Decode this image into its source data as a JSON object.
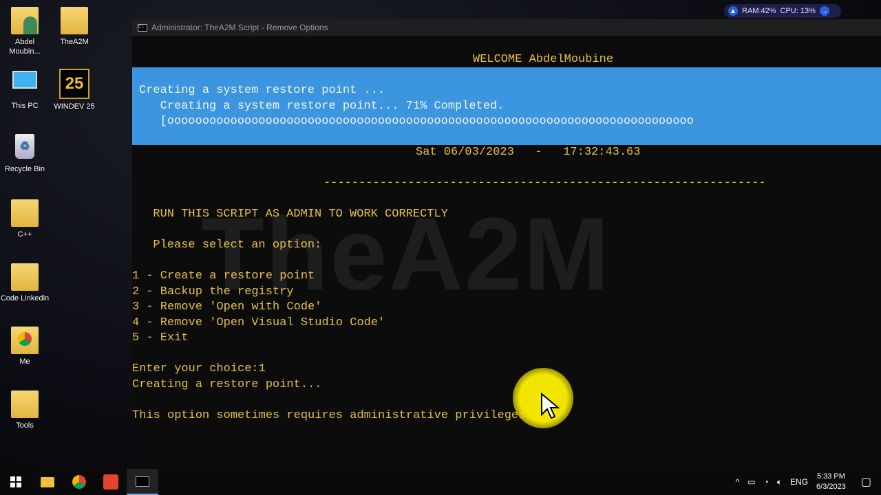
{
  "desktop": {
    "icons": [
      {
        "label": "Abdel Moubin...",
        "icon": "user-folder-icon"
      },
      {
        "label": "TheA2M",
        "icon": "folder-icon"
      },
      {
        "label": "This PC",
        "icon": "computer-icon"
      },
      {
        "label": "WINDEV 25",
        "icon": "windev-icon"
      },
      {
        "label": "Recycle Bin",
        "icon": "recycle-bin-icon"
      },
      {
        "label": "C++",
        "icon": "folder-icon"
      },
      {
        "label": "Code Linkedin",
        "icon": "folder-icon"
      },
      {
        "label": "Me",
        "icon": "chrome-folder-icon"
      },
      {
        "label": "Tools",
        "icon": "folder-icon"
      }
    ]
  },
  "widget": {
    "ram": "RAM:42%",
    "cpu": "CPU: 13%"
  },
  "window": {
    "title": "Administrator:  TheA2M Script - Remove Options"
  },
  "console": {
    "welcome": "WELCOME AbdelMoubine",
    "progress_title": "Creating a system restore point ...",
    "progress_line": "   Creating a system restore point... 71% Completed.",
    "progress_percent": 71,
    "progress_bar": "   [ooooooooooooooooooooooooooooooooooooooooooooooooooooooooooooooooooooooooooo",
    "datetime": "Sat 06/03/2023   -   17:32:43.63",
    "separator": "---------------------------------------------------------------",
    "admin_note": "  RUN THIS SCRIPT AS ADMIN TO WORK CORRECTLY",
    "prompt": "  Please select an option:",
    "options": [
      "1 - Create a restore point",
      "2 - Backup the registry",
      "3 - Remove 'Open with Code'",
      "4 - Remove 'Open Visual Studio Code'",
      "5 - Exit"
    ],
    "choice": "Enter your choice:1",
    "status": "Creating a restore point...",
    "note": "This option sometimes requires administrative privileges.",
    "watermark": "TheA2M"
  },
  "taskbar": {
    "lang": "ENG",
    "time": "5:33 PM",
    "date": "6/3/2023"
  }
}
